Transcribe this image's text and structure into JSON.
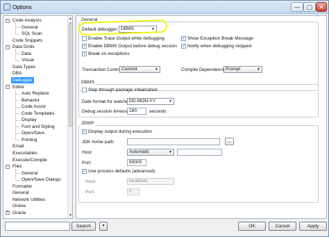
{
  "window": {
    "title": "Options",
    "minimize": "—",
    "maximize": "▢",
    "close": "✕"
  },
  "tree": {
    "items": [
      {
        "label": "Code Analysis",
        "expandable": true,
        "expanded": true
      },
      {
        "label": "General"
      },
      {
        "label": "SQL Scan"
      },
      {
        "label": "Code Snippets"
      },
      {
        "label": "Data Grids",
        "expandable": true,
        "expanded": true
      },
      {
        "label": "Data"
      },
      {
        "label": "Visual"
      },
      {
        "label": "Data Types"
      },
      {
        "label": "DBA"
      },
      {
        "label": "Debugger",
        "selected": true
      },
      {
        "label": "Editor",
        "expandable": true,
        "expanded": true
      },
      {
        "label": "Auto Replace"
      },
      {
        "label": "Behavior"
      },
      {
        "label": "Code Assist"
      },
      {
        "label": "Code Templates"
      },
      {
        "label": "Display"
      },
      {
        "label": "Font and Styling"
      },
      {
        "label": "Open/Save"
      },
      {
        "label": "Printing"
      },
      {
        "label": "Email"
      },
      {
        "label": "Executables"
      },
      {
        "label": "Execute/Compile"
      },
      {
        "label": "Files",
        "expandable": true,
        "expanded": true
      },
      {
        "label": "General"
      },
      {
        "label": "Open/Save Dialogs"
      },
      {
        "label": "Formatter"
      },
      {
        "label": "General"
      },
      {
        "label": "Network Utilities"
      },
      {
        "label": "Online"
      },
      {
        "label": "Oracle",
        "expandable": true,
        "expanded": false
      }
    ]
  },
  "general": {
    "title": "General",
    "default_debugger_label": "Default debugger:",
    "default_debugger_value": "DBMS",
    "enable_trace_label": "Enable Trace Output while debugging",
    "enable_trace_checked": false,
    "enable_dbms_output_label": "Enable DBMS Output before debug session",
    "enable_dbms_output_checked": true,
    "break_on_exceptions_label": "Break on exceptions",
    "break_on_exceptions_checked": true,
    "show_exception_label": "Show Exception Break Message",
    "show_exception_checked": true,
    "notify_stopped_label": "Notify when debugging stopped",
    "notify_stopped_checked": true,
    "transaction_control_label": "Transaction Control:",
    "transaction_control_value": "Commit",
    "compile_dependencies_label": "Compile Dependencies:",
    "compile_dependencies_value": "Prompt"
  },
  "dbms": {
    "title": "DBMS",
    "step_through_label": "Step through package initialization",
    "step_through_checked": false,
    "date_format_label": "Date format for watches:",
    "date_format_value": "DD-MON-YY",
    "timeout_label": "Debug session timeout:",
    "timeout_value": "180",
    "timeout_unit": "seconds"
  },
  "jdwp": {
    "title": "JDWP",
    "display_output_label": "Display output during execution",
    "display_output_checked": true,
    "jdk_home_label": "JDK home path:",
    "jdk_home_value": "",
    "browse_label": "...",
    "host_label": "Host:",
    "host_select_value": "Automatic",
    "host_value": "",
    "port_label": "Port:",
    "port_value": "50000",
    "use_process_defaults_label": "Use process defaults (advanced)",
    "use_process_defaults_checked": true,
    "proc_host_label": "Host:",
    "proc_host_value": "localhost",
    "proc_port_label": "Port:",
    "proc_port_value": "0"
  },
  "footer": {
    "search_value": "",
    "search_label": "Search",
    "ok_label": "OK",
    "cancel_label": "Cancel",
    "apply_label": "Apply"
  },
  "colors": {
    "highlight": "#f4f40c",
    "selection": "#3399ff"
  }
}
